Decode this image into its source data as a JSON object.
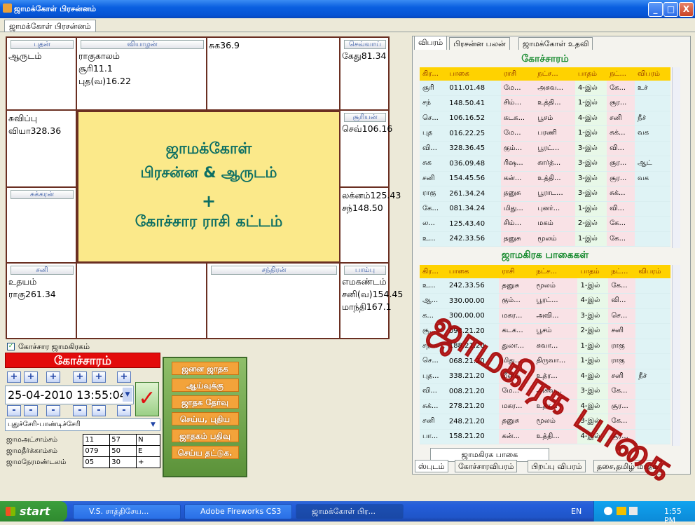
{
  "window": {
    "title": "ஜாமக்கோள் பிரசன்னம்",
    "main_tab": "ஜாமக்கோள் பிரசன்னம்",
    "min": "_",
    "max": "□",
    "close": "X"
  },
  "chart": {
    "cells": [
      {
        "label": "புதன்",
        "lines": [
          "ஆருடம்"
        ]
      },
      {
        "label": "வியாழன்",
        "lines": [
          "ராகுகாலம்",
          "சூரி11.1",
          "புத(வ)16.22"
        ]
      },
      {
        "label": "",
        "lines": [
          "சுக36.9"
        ]
      },
      {
        "label": "செவ்வாய்",
        "lines": [
          "கேது81.34"
        ]
      },
      {
        "label": "",
        "lines": [
          "சுவிப்பு",
          "வியா328.36"
        ]
      },
      {
        "label": "சூரியன்",
        "lines": [
          "செவ்106.16"
        ]
      },
      {
        "label": "சுக்கரன்",
        "lines": []
      },
      {
        "label": "",
        "lines": [
          "லக்னம்125.43",
          "சந்148.50"
        ]
      },
      {
        "label": "சனி",
        "lines": [
          "உதயம்",
          "ராகு261.34"
        ]
      },
      {
        "label": "",
        "lines": []
      },
      {
        "label": "சந்திரன்",
        "lines": []
      },
      {
        "label": "பாம்பு",
        "lines": [
          "எமகண்டம்",
          "சனி(வ)154.45",
          "மாந்தி167.1"
        ]
      }
    ],
    "center": {
      "line1": "ஜாமக்கோள்",
      "line2": "பிரசன்ன & ஆருடம்",
      "line3": "+",
      "line4": "கோச்சார ராசி கட்டம்"
    }
  },
  "right": {
    "tabs": [
      "விபரம்",
      "பிரசன்ன பலன்",
      "ஜாமக்கோள் உதவி"
    ],
    "gochara_title": "கோச்சாரம்",
    "headers": [
      "கிர...",
      "பாகை",
      "ராசி",
      "நட்ச...",
      "பாதம்",
      "நட்...",
      "விபரம்"
    ],
    "gochara_rows": [
      [
        "சூரி",
        "011.01.48",
        "மே...",
        "அசுவ...",
        "4-இல்",
        "கே...",
        "உச்"
      ],
      [
        "சந்",
        "148.50.41",
        "சிம்...",
        "உத்தி...",
        "1-இல்",
        "சூர...",
        ""
      ],
      [
        "செ...",
        "106.16.52",
        "கடக...",
        "பூசம்",
        "4-இல்",
        "சனி",
        "நீச்"
      ],
      [
        "புத",
        "016.22.25",
        "மே...",
        "பரணி",
        "1-இல்",
        "சுக்...",
        "வக"
      ],
      [
        "வி...",
        "328.36.45",
        "கும்...",
        "பூரட்...",
        "3-இல்",
        "வி...",
        ""
      ],
      [
        "சுக",
        "036.09.48",
        "ரிஷ...",
        "கார்த்...",
        "3-இல்",
        "சூர...",
        "ஆட்"
      ],
      [
        "சனி",
        "154.45.56",
        "கன்...",
        "உத்தி...",
        "3-இல்",
        "சூர...",
        "வக"
      ],
      [
        "ராகு",
        "261.34.24",
        "தனுசு",
        "பூராட...",
        "3-இல்",
        "சுக்...",
        ""
      ],
      [
        "கே...",
        "081.34.24",
        "மிது...",
        "புனர்...",
        "1-இல்",
        "வி...",
        ""
      ],
      [
        "ல...",
        "125.43.40",
        "சிம்...",
        "மகம்",
        "2-இல்",
        "கே...",
        ""
      ],
      [
        "உ...",
        "242.33.56",
        "தனுசு",
        "மூலம்",
        "1-இல்",
        "கே...",
        ""
      ]
    ],
    "jama_title": "ஜாமகிரக பாகைகள்",
    "jama_rows": [
      [
        "உ...",
        "242.33.56",
        "தனுசு",
        "மூலம்",
        "1-இல்",
        "கே...",
        ""
      ],
      [
        "ஆ...",
        "330.00.00",
        "கும்...",
        "பூரட்...",
        "4-இல்",
        "வி...",
        ""
      ],
      [
        "க...",
        "300.00.00",
        "மகர...",
        "அவி...",
        "3-இல்",
        "செ...",
        ""
      ],
      [
        "சூ...",
        "098.21.20",
        "கடக...",
        "பூசம்",
        "2-இல்",
        "சனி",
        ""
      ],
      [
        "சந்...",
        "188.21.20",
        "துலா...",
        "சுவா...",
        "1-இல்",
        "ராகு",
        ""
      ],
      [
        "செ...",
        "068.21.20",
        "மிது...",
        "திருவா...",
        "1-இல்",
        "ராகு",
        ""
      ],
      [
        "புத...",
        "338.21.20",
        "மீனம்",
        "உத்ர...",
        "4-இல்",
        "சனி",
        "நீச்"
      ],
      [
        "வி...",
        "008.21.20",
        "மே...",
        "அசுவ...",
        "3-இல்",
        "கே...",
        ""
      ],
      [
        "சுக்...",
        "278.21.20",
        "மகர...",
        "உத்ர...",
        "4-இல்",
        "சூர...",
        ""
      ],
      [
        "சனி",
        "248.21.20",
        "தனுசு",
        "மூலம்",
        "3-இல்",
        "கே...",
        ""
      ],
      [
        "பா...",
        "158.21.20",
        "கன்...",
        "உத்தி...",
        "4-இல்",
        "சூர...",
        ""
      ]
    ],
    "jama_button": "ஜாமகிரக பாகை",
    "bottom_tabs": [
      "ஸ்புடம்",
      "கோச்சாரவிபரம்",
      "பிறப்பு விபரம்",
      "தசை,தமிழ் மாதம்"
    ],
    "watermark": "ஜாமகிரக பாகை"
  },
  "controls": {
    "checkbox_label": "கோச்சார ஜாமகிரகம்",
    "gochara_header": "கோச்சாரம்",
    "plus": "+",
    "minus": "-",
    "datetime": "25-04-2010 13:55:04",
    "check": "✓",
    "place": "புதுச்சேரி-பாண்டிச்சேரி",
    "coords": [
      {
        "label": "ஜாமஅட்சாம்சம்",
        "v1": "11",
        "v2": "57",
        "v3": "N"
      },
      {
        "label": "ஜாமதீர்க்காம்சம்",
        "v1": "079",
        "v2": "50",
        "v3": "E"
      },
      {
        "label": "ஜாமநேரமண்டலம்",
        "v1": "05",
        "v2": "30",
        "v3": "+"
      }
    ],
    "green_box": [
      "ஜனன ஜாதக",
      "ஆய்வுக்கு",
      "ஜாதக தேர்வு",
      "செய்ய, புதிய",
      "ஜாதகம் பதிவு",
      "செய்ய தட்டுக."
    ]
  },
  "taskbar": {
    "start": "start",
    "tasks": [
      "V.S. சாத்திசேய...",
      "Adobe Fireworks CS3",
      "ஜாமக்கோள் பிர..."
    ],
    "lang": "EN",
    "time": "1:55 PM"
  }
}
